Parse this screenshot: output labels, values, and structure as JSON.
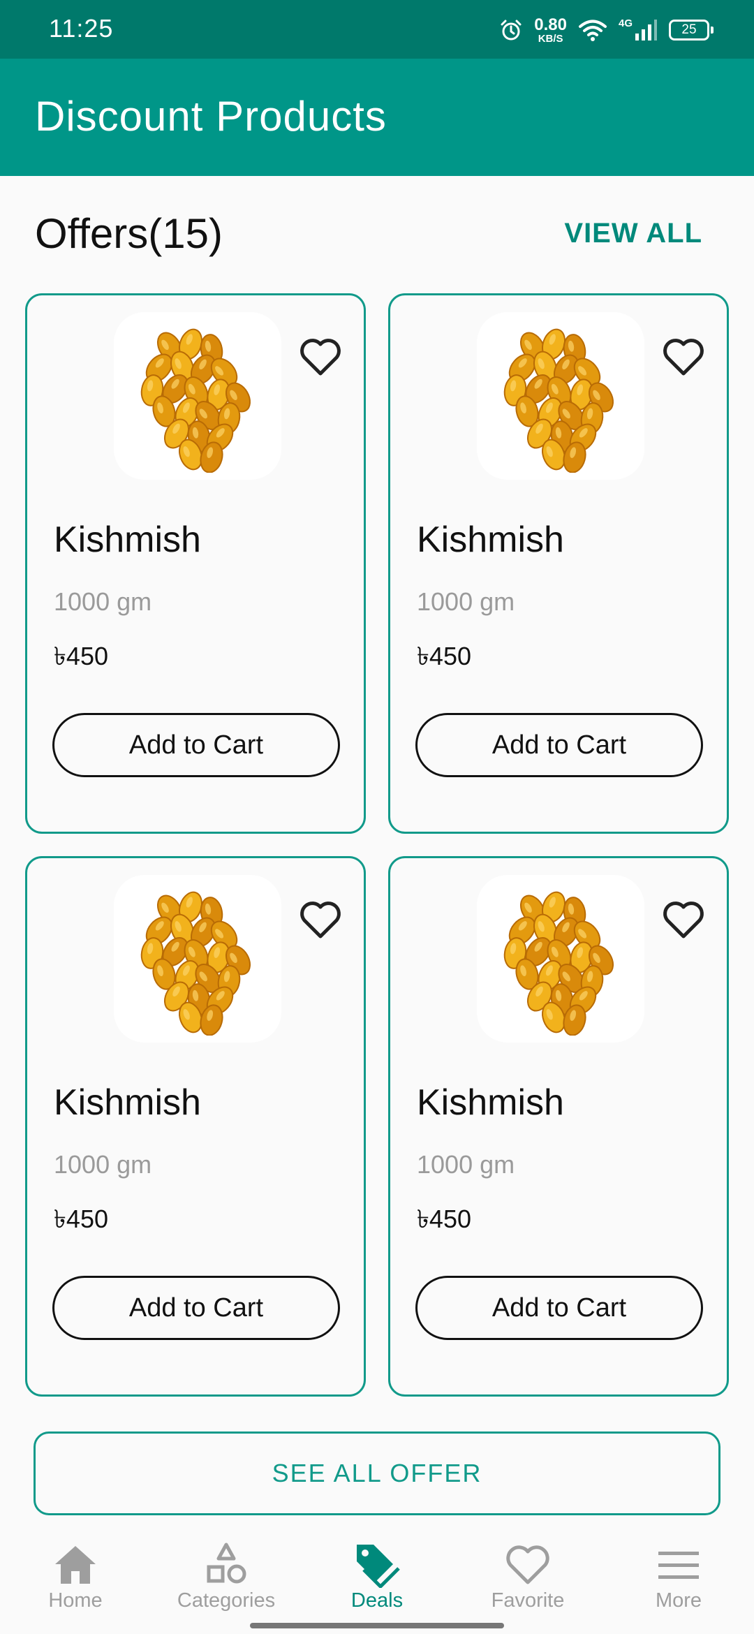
{
  "status_bar": {
    "time": "11:25",
    "net_speed": "0.80",
    "net_unit": "KB/S",
    "network": "4G",
    "battery": "25",
    "icons": [
      "alarm-icon",
      "wifi-icon",
      "signal-icon",
      "battery-icon"
    ]
  },
  "app_bar": {
    "title": "Discount Products"
  },
  "section": {
    "title": "Offers(15)",
    "view_all": "VIEW ALL"
  },
  "products": [
    {
      "name": "Kishmish",
      "weight": "1000 gm",
      "price": "৳450",
      "cta": "Add to Cart",
      "icon": "raisins-image"
    },
    {
      "name": "Kishmish",
      "weight": "1000 gm",
      "price": "৳450",
      "cta": "Add to Cart",
      "icon": "raisins-image"
    },
    {
      "name": "Kishmish",
      "weight": "1000 gm",
      "price": "৳450",
      "cta": "Add to Cart",
      "icon": "raisins-image"
    },
    {
      "name": "Kishmish",
      "weight": "1000 gm",
      "price": "৳450",
      "cta": "Add to Cart",
      "icon": "raisins-image"
    }
  ],
  "see_all_button": "SEE ALL OFFER",
  "bottom_nav": [
    {
      "label": "Home",
      "icon": "home-icon",
      "active": false
    },
    {
      "label": "Categories",
      "icon": "categories-icon",
      "active": false
    },
    {
      "label": "Deals",
      "icon": "tag-icon",
      "active": true
    },
    {
      "label": "Favorite",
      "icon": "heart-icon",
      "active": false
    },
    {
      "label": "More",
      "icon": "menu-icon",
      "active": false
    }
  ],
  "colors": {
    "status_bar": "#00796b",
    "app_bar": "#009688",
    "accent": "#00897b",
    "card_border": "#119a8a"
  }
}
